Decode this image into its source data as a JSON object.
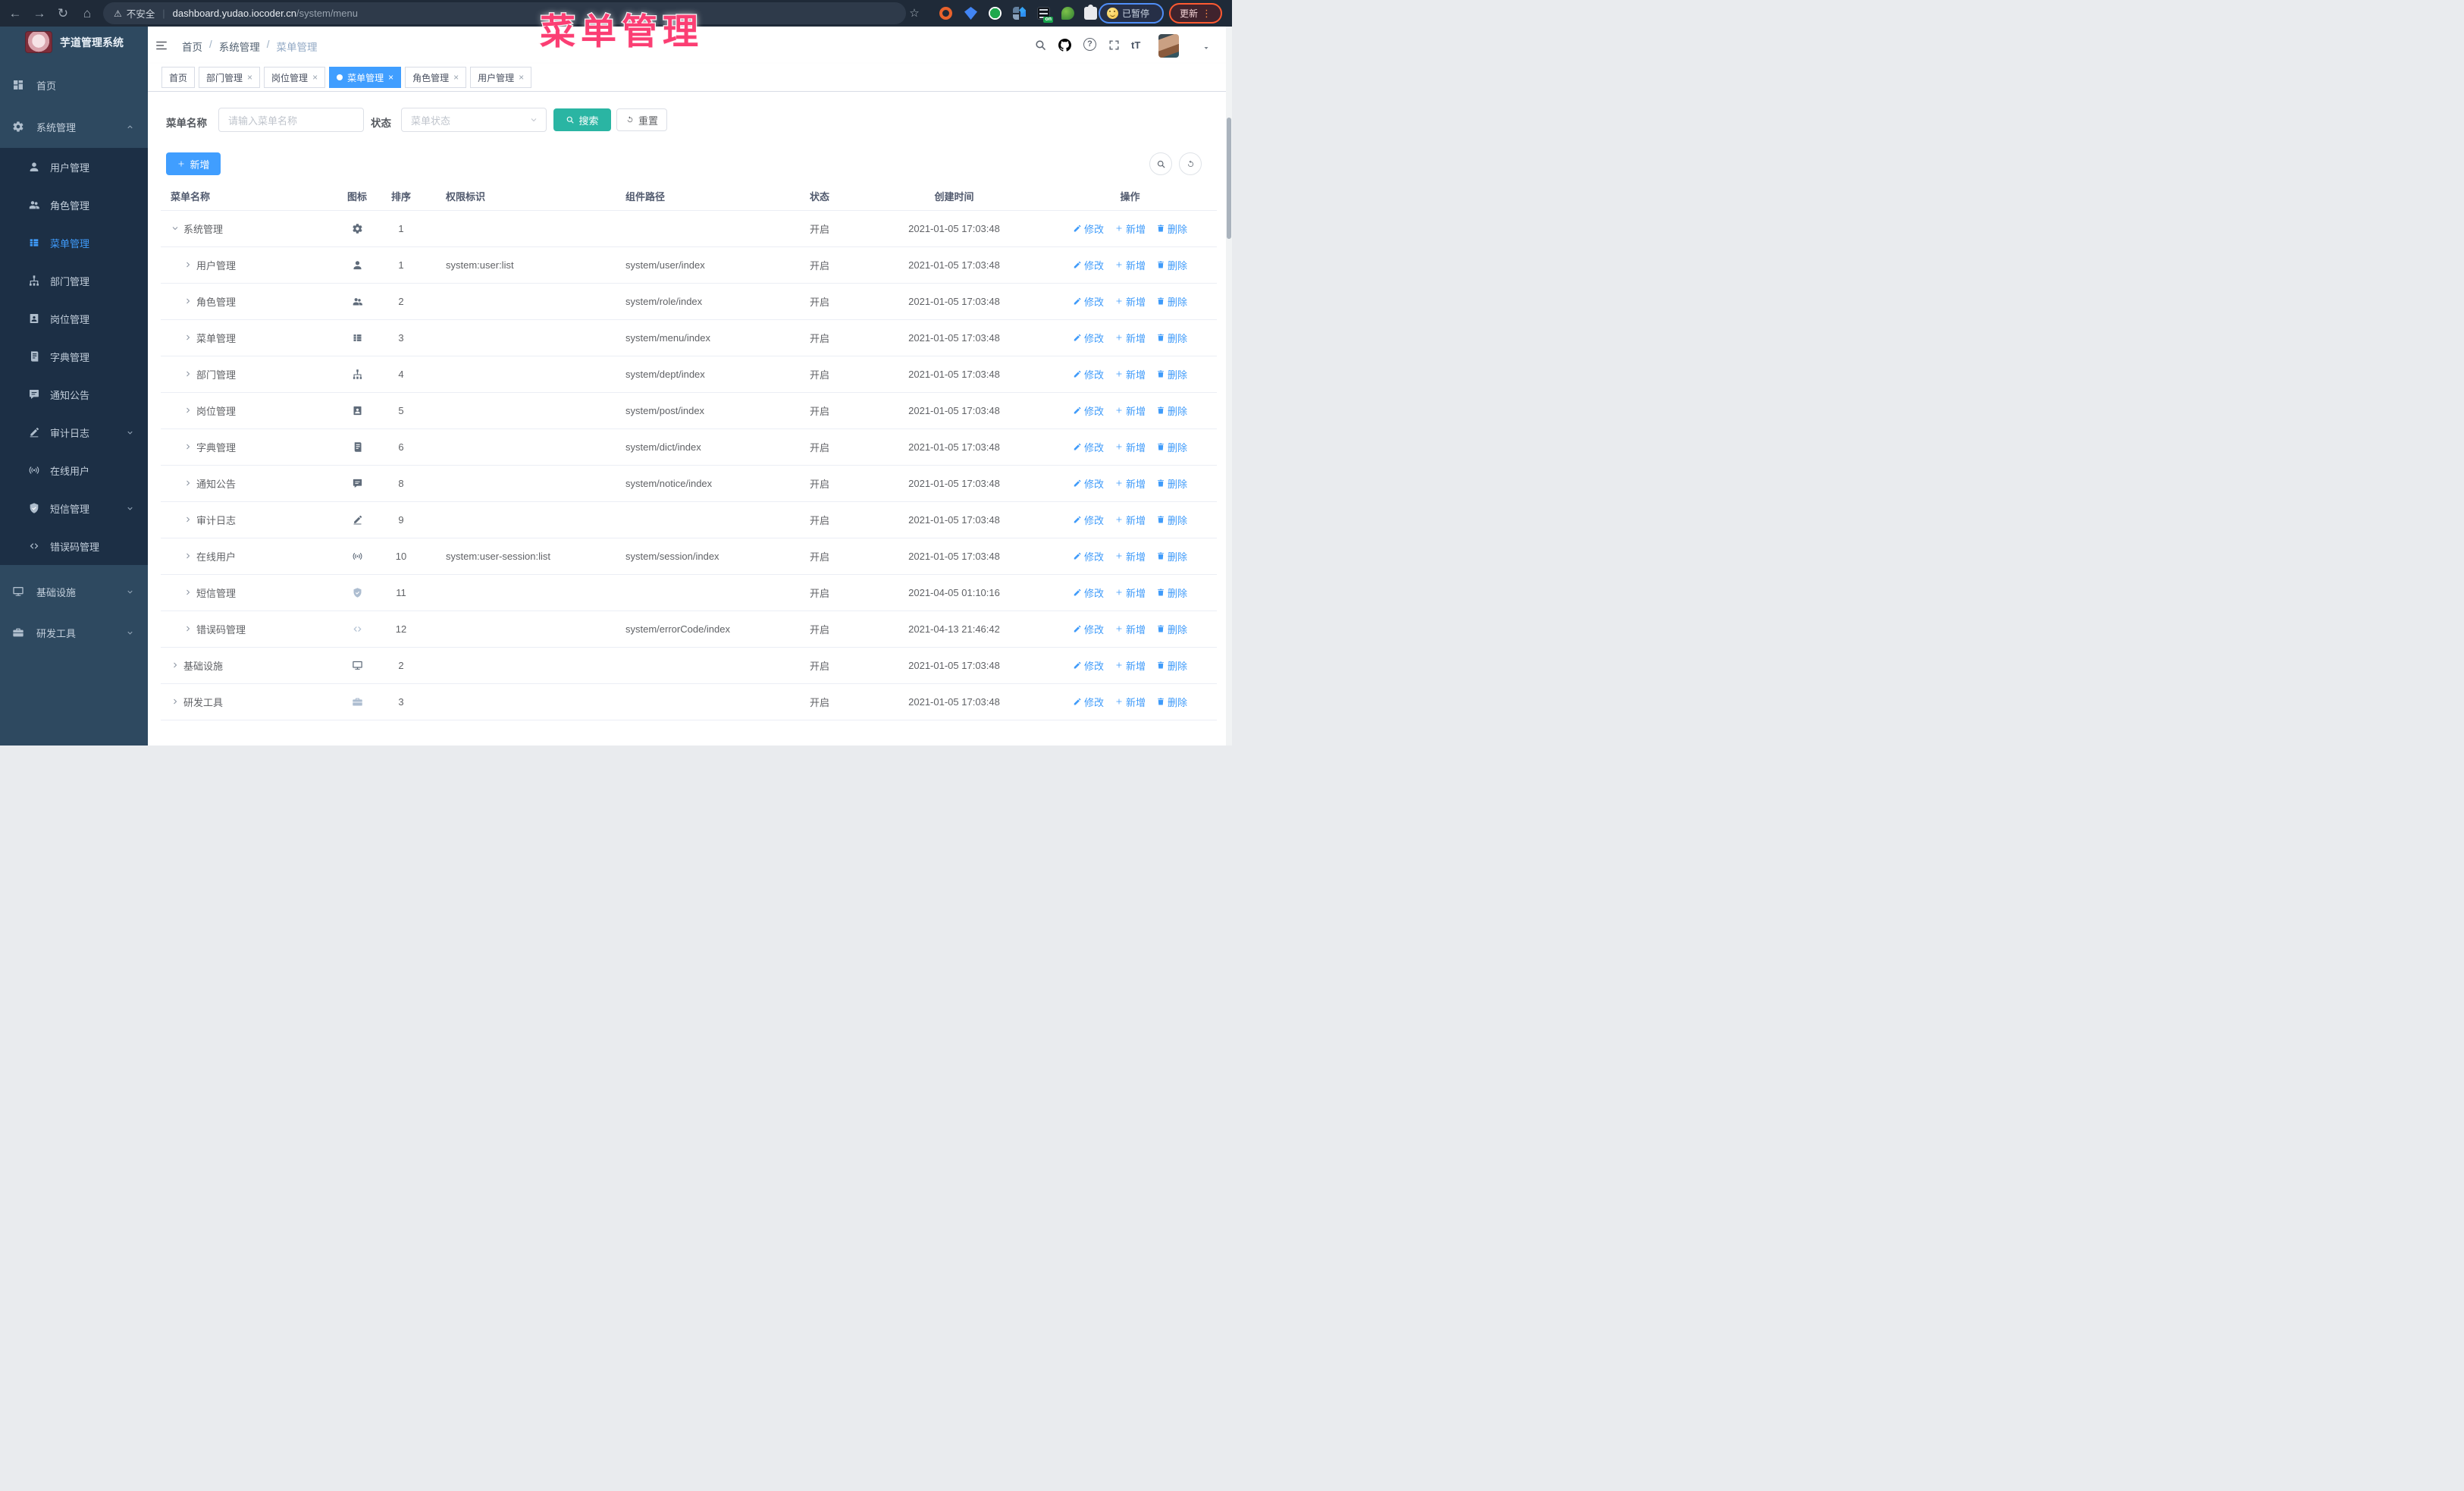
{
  "browser": {
    "security_label": "不安全",
    "url_host": "dashboard.yudao.iocoder.cn",
    "url_path": "/system/menu",
    "glyphs": {
      "back": "←",
      "forward": "→",
      "reload": "↻",
      "home": "⌂",
      "warning": "⚠",
      "star": "☆",
      "divider": "|",
      "kebab": "⋮"
    },
    "ext_on_label": "on",
    "paused_label": "已暂停",
    "update_label": "更新"
  },
  "annotation": {
    "title": "菜单管理"
  },
  "app": {
    "logo_title": "芋道管理系统",
    "breadcrumb": {
      "items": [
        "首页",
        "系统管理",
        "菜单管理"
      ],
      "separator": "/"
    },
    "header": {
      "help_glyph": "?",
      "fontsize_glyph": "tT"
    },
    "sidebar": {
      "items": [
        {
          "label": "首页",
          "icon": "home",
          "level": 0
        },
        {
          "label": "系统管理",
          "icon": "gear",
          "level": 0,
          "chevron": "up"
        },
        {
          "label": "用户管理",
          "icon": "user",
          "level": 1
        },
        {
          "label": "角色管理",
          "icon": "users",
          "level": 1
        },
        {
          "label": "菜单管理",
          "icon": "menu",
          "level": 1,
          "active": true
        },
        {
          "label": "部门管理",
          "icon": "tree",
          "level": 1
        },
        {
          "label": "岗位管理",
          "icon": "badge",
          "level": 1
        },
        {
          "label": "字典管理",
          "icon": "book",
          "level": 1
        },
        {
          "label": "通知公告",
          "icon": "message",
          "level": 1
        },
        {
          "label": "审计日志",
          "icon": "edit",
          "level": 1,
          "chevron": "down"
        },
        {
          "label": "在线用户",
          "icon": "online",
          "level": 1
        },
        {
          "label": "短信管理",
          "icon": "shield",
          "level": 1,
          "chevron": "down"
        },
        {
          "label": "错误码管理",
          "icon": "code",
          "level": 1
        },
        {
          "label": "基础设施",
          "icon": "monitor",
          "level": 0,
          "chevron": "down"
        },
        {
          "label": "研发工具",
          "icon": "tool",
          "level": 0,
          "chevron": "down"
        }
      ]
    },
    "tabs": {
      "close_glyph": "×",
      "items": [
        {
          "label": "首页",
          "closable": false,
          "active": false
        },
        {
          "label": "部门管理",
          "closable": true,
          "active": false
        },
        {
          "label": "岗位管理",
          "closable": true,
          "active": false
        },
        {
          "label": "菜单管理",
          "closable": true,
          "active": true
        },
        {
          "label": "角色管理",
          "closable": true,
          "active": false
        },
        {
          "label": "用户管理",
          "closable": true,
          "active": false
        }
      ]
    }
  },
  "search": {
    "name_label": "菜单名称",
    "name_placeholder": "请输入菜单名称",
    "status_label": "状态",
    "status_placeholder": "菜单状态",
    "search_label": "搜索",
    "reset_label": "重置",
    "add_label": "新增"
  },
  "table": {
    "columns": [
      "菜单名称",
      "图标",
      "排序",
      "权限标识",
      "组件路径",
      "状态",
      "创建时间",
      "操作"
    ],
    "actions": {
      "edit": "修改",
      "add": "新增",
      "delete": "删除"
    },
    "rows": [
      {
        "name": "系统管理",
        "icon": "gear",
        "sort": "1",
        "perm": "",
        "path": "",
        "status": "开启",
        "time": "2021-01-05 17:03:48",
        "level": 0,
        "expanded": true
      },
      {
        "name": "用户管理",
        "icon": "user",
        "sort": "1",
        "perm": "system:user:list",
        "path": "system/user/index",
        "status": "开启",
        "time": "2021-01-05 17:03:48",
        "level": 1
      },
      {
        "name": "角色管理",
        "icon": "users",
        "sort": "2",
        "perm": "",
        "path": "system/role/index",
        "status": "开启",
        "time": "2021-01-05 17:03:48",
        "level": 1
      },
      {
        "name": "菜单管理",
        "icon": "menu",
        "sort": "3",
        "perm": "",
        "path": "system/menu/index",
        "status": "开启",
        "time": "2021-01-05 17:03:48",
        "level": 1
      },
      {
        "name": "部门管理",
        "icon": "tree",
        "sort": "4",
        "perm": "",
        "path": "system/dept/index",
        "status": "开启",
        "time": "2021-01-05 17:03:48",
        "level": 1
      },
      {
        "name": "岗位管理",
        "icon": "badge",
        "sort": "5",
        "perm": "",
        "path": "system/post/index",
        "status": "开启",
        "time": "2021-01-05 17:03:48",
        "level": 1
      },
      {
        "name": "字典管理",
        "icon": "book",
        "sort": "6",
        "perm": "",
        "path": "system/dict/index",
        "status": "开启",
        "time": "2021-01-05 17:03:48",
        "level": 1
      },
      {
        "name": "通知公告",
        "icon": "message",
        "sort": "8",
        "perm": "",
        "path": "system/notice/index",
        "status": "开启",
        "time": "2021-01-05 17:03:48",
        "level": 1
      },
      {
        "name": "审计日志",
        "icon": "edit",
        "sort": "9",
        "perm": "",
        "path": "",
        "status": "开启",
        "time": "2021-01-05 17:03:48",
        "level": 1
      },
      {
        "name": "在线用户",
        "icon": "online",
        "sort": "10",
        "perm": "system:user-session:list",
        "path": "system/session/index",
        "status": "开启",
        "time": "2021-01-05 17:03:48",
        "level": 1
      },
      {
        "name": "短信管理",
        "icon": "shield",
        "sort": "11",
        "perm": "",
        "path": "",
        "status": "开启",
        "time": "2021-04-05 01:10:16",
        "level": 1,
        "muted": true
      },
      {
        "name": "错误码管理",
        "icon": "code",
        "sort": "12",
        "perm": "",
        "path": "system/errorCode/index",
        "status": "开启",
        "time": "2021-04-13 21:46:42",
        "level": 1,
        "muted": true
      },
      {
        "name": "基础设施",
        "icon": "monitor",
        "sort": "2",
        "perm": "",
        "path": "",
        "status": "开启",
        "time": "2021-01-05 17:03:48",
        "level": 0
      },
      {
        "name": "研发工具",
        "icon": "tool",
        "sort": "3",
        "perm": "",
        "path": "",
        "status": "开启",
        "time": "2021-01-05 17:03:48",
        "level": 0,
        "muted": true
      }
    ]
  }
}
